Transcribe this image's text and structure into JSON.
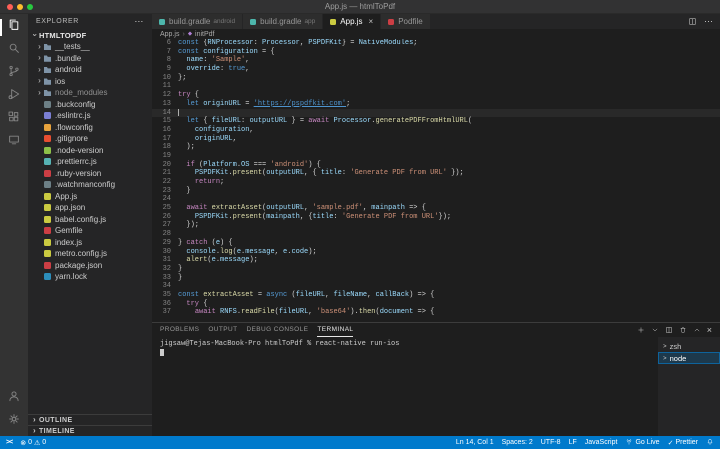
{
  "colors": {
    "accent": "#007acc",
    "traffic_lights": [
      "#ff5f57",
      "#febc2e",
      "#28c840"
    ],
    "folder_icon": "#7e93a7"
  },
  "glyphs": {
    "more": "⋯",
    "close": "×",
    "chevron": "›",
    "check": "✓",
    "error": "⊗",
    "warning": "⚠"
  },
  "title_bar": {
    "title": "App.js — htmlToPdf"
  },
  "activity_bar": {
    "items": [
      {
        "name": "explorer",
        "active": true
      },
      {
        "name": "search"
      },
      {
        "name": "source-control"
      },
      {
        "name": "run-debug"
      },
      {
        "name": "extensions"
      },
      {
        "name": "remote-explorer"
      }
    ],
    "bottom": [
      {
        "name": "account"
      },
      {
        "name": "settings"
      }
    ]
  },
  "sidebar": {
    "header": "EXPLORER",
    "section": "HTMLTOPDF",
    "files": [
      {
        "name": "__tests__",
        "kind": "folder"
      },
      {
        "name": ".bundle",
        "kind": "folder"
      },
      {
        "name": "android",
        "kind": "folder"
      },
      {
        "name": "ios",
        "kind": "folder"
      },
      {
        "name": "node_modules",
        "kind": "folder",
        "dim": true
      },
      {
        "name": ".buckconfig",
        "color": "#6d8086"
      },
      {
        "name": ".eslintrc.js",
        "color": "#7b7fd4"
      },
      {
        "name": ".flowconfig",
        "color": "#e8a33d"
      },
      {
        "name": ".gitignore",
        "color": "#e84e31"
      },
      {
        "name": ".node-version",
        "color": "#8dc149"
      },
      {
        "name": ".prettierrc.js",
        "color": "#56b3b4"
      },
      {
        "name": ".ruby-version",
        "color": "#cc3e44"
      },
      {
        "name": ".watchmanconfig",
        "color": "#6d8086"
      },
      {
        "name": "App.js",
        "color": "#cbcb41"
      },
      {
        "name": "app.json",
        "color": "#cbcb41"
      },
      {
        "name": "babel.config.js",
        "color": "#cbcb41"
      },
      {
        "name": "Gemfile",
        "color": "#cc3e44"
      },
      {
        "name": "index.js",
        "color": "#cbcb41"
      },
      {
        "name": "metro.config.js",
        "color": "#cbcb41"
      },
      {
        "name": "package.json",
        "color": "#cc3e44"
      },
      {
        "name": "yarn.lock",
        "color": "#2c8ebb"
      }
    ],
    "panels": [
      "OUTLINE",
      "TIMELINE"
    ]
  },
  "tabs": [
    {
      "label": "build.gradle",
      "detail": "android",
      "icon_color": "#4db6ac"
    },
    {
      "label": "build.gradle",
      "detail": "app",
      "icon_color": "#4db6ac"
    },
    {
      "label": "App.js",
      "icon_color": "#cbcb41",
      "active": true,
      "closable": true
    },
    {
      "label": "Podfile",
      "icon_color": "#cc3e44"
    }
  ],
  "breadcrumb": {
    "items": [
      "App.js",
      "initPdf"
    ]
  },
  "editor": {
    "cursor_line": 14,
    "lines": [
      {
        "n": 6,
        "t": [
          [
            "k",
            "const"
          ],
          [
            "p",
            " {"
          ],
          [
            "v",
            "RNProcessor"
          ],
          [
            "p",
            ": "
          ],
          [
            "v",
            "Processor"
          ],
          [
            "p",
            ", "
          ],
          [
            "v",
            "PSPDFKit"
          ],
          [
            "p",
            "} = "
          ],
          [
            "v",
            "NativeModules"
          ],
          [
            "p",
            ";"
          ]
        ]
      },
      {
        "n": 7,
        "t": [
          [
            "k",
            "const"
          ],
          [
            "p",
            " "
          ],
          [
            "v",
            "configuration"
          ],
          [
            "p",
            " = {"
          ]
        ]
      },
      {
        "n": 8,
        "t": [
          [
            "p",
            "  "
          ],
          [
            "v",
            "name"
          ],
          [
            "p",
            ": "
          ],
          [
            "s",
            "'Sample'"
          ],
          [
            "p",
            ","
          ]
        ]
      },
      {
        "n": 9,
        "t": [
          [
            "p",
            "  "
          ],
          [
            "v",
            "override"
          ],
          [
            "p",
            ": "
          ],
          [
            "b",
            "true"
          ],
          [
            "p",
            ","
          ]
        ]
      },
      {
        "n": 10,
        "t": [
          [
            "p",
            "};"
          ]
        ]
      },
      {
        "n": 11,
        "t": []
      },
      {
        "n": 12,
        "t": [
          [
            "c",
            "try"
          ],
          [
            "p",
            " {"
          ]
        ]
      },
      {
        "n": 13,
        "t": [
          [
            "p",
            "  "
          ],
          [
            "k",
            "let"
          ],
          [
            "p",
            " "
          ],
          [
            "v",
            "originURL"
          ],
          [
            "p",
            " = "
          ],
          [
            "u",
            "'https://pspdfkit.com'"
          ],
          [
            "p",
            ";"
          ]
        ]
      },
      {
        "n": 14,
        "t": []
      },
      {
        "n": 15,
        "t": [
          [
            "p",
            "  "
          ],
          [
            "k",
            "let"
          ],
          [
            "p",
            " { "
          ],
          [
            "v",
            "fileURL"
          ],
          [
            "p",
            ": "
          ],
          [
            "v",
            "outputURL"
          ],
          [
            "p",
            " } = "
          ],
          [
            "c",
            "await"
          ],
          [
            "p",
            " "
          ],
          [
            "v",
            "Processor"
          ],
          [
            "p",
            "."
          ],
          [
            "f",
            "generatePDFFromHtmlURL"
          ],
          [
            "p",
            "("
          ]
        ]
      },
      {
        "n": 16,
        "t": [
          [
            "p",
            "    "
          ],
          [
            "v",
            "configuration"
          ],
          [
            "p",
            ","
          ]
        ]
      },
      {
        "n": 17,
        "t": [
          [
            "p",
            "    "
          ],
          [
            "v",
            "originURL"
          ],
          [
            "p",
            ","
          ]
        ]
      },
      {
        "n": 18,
        "t": [
          [
            "p",
            "  );"
          ]
        ]
      },
      {
        "n": 19,
        "t": []
      },
      {
        "n": 20,
        "t": [
          [
            "p",
            "  "
          ],
          [
            "c",
            "if"
          ],
          [
            "p",
            " ("
          ],
          [
            "v",
            "Platform"
          ],
          [
            "p",
            "."
          ],
          [
            "v",
            "OS"
          ],
          [
            "p",
            " === "
          ],
          [
            "s",
            "'android'"
          ],
          [
            "p",
            ") {"
          ]
        ]
      },
      {
        "n": 21,
        "t": [
          [
            "p",
            "    "
          ],
          [
            "v",
            "PSPDFKit"
          ],
          [
            "p",
            "."
          ],
          [
            "f",
            "present"
          ],
          [
            "p",
            "("
          ],
          [
            "v",
            "outputURL"
          ],
          [
            "p",
            ", { "
          ],
          [
            "v",
            "title"
          ],
          [
            "p",
            ": "
          ],
          [
            "s",
            "'Generate PDF from URL'"
          ],
          [
            "p",
            " });"
          ]
        ]
      },
      {
        "n": 22,
        "t": [
          [
            "p",
            "    "
          ],
          [
            "c",
            "return"
          ],
          [
            "p",
            ";"
          ]
        ]
      },
      {
        "n": 23,
        "t": [
          [
            "p",
            "  }"
          ]
        ]
      },
      {
        "n": 24,
        "t": []
      },
      {
        "n": 25,
        "t": [
          [
            "p",
            "  "
          ],
          [
            "c",
            "await"
          ],
          [
            "p",
            " "
          ],
          [
            "f",
            "extractAsset"
          ],
          [
            "p",
            "("
          ],
          [
            "v",
            "outputURL"
          ],
          [
            "p",
            ", "
          ],
          [
            "s",
            "'sample.pdf'"
          ],
          [
            "p",
            ", "
          ],
          [
            "v",
            "mainpath"
          ],
          [
            "p",
            " => {"
          ]
        ]
      },
      {
        "n": 26,
        "t": [
          [
            "p",
            "    "
          ],
          [
            "v",
            "PSPDFKit"
          ],
          [
            "p",
            "."
          ],
          [
            "f",
            "present"
          ],
          [
            "p",
            "("
          ],
          [
            "v",
            "mainpath"
          ],
          [
            "p",
            ", {"
          ],
          [
            "v",
            "title"
          ],
          [
            "p",
            ": "
          ],
          [
            "s",
            "'Generate PDF from URL'"
          ],
          [
            "p",
            "});"
          ]
        ]
      },
      {
        "n": 27,
        "t": [
          [
            "p",
            "  });"
          ]
        ]
      },
      {
        "n": 28,
        "t": []
      },
      {
        "n": 29,
        "t": [
          [
            "p",
            "} "
          ],
          [
            "c",
            "catch"
          ],
          [
            "p",
            " ("
          ],
          [
            "v",
            "e"
          ],
          [
            "p",
            ") {"
          ]
        ]
      },
      {
        "n": 30,
        "t": [
          [
            "p",
            "  "
          ],
          [
            "v",
            "console"
          ],
          [
            "p",
            "."
          ],
          [
            "f",
            "log"
          ],
          [
            "p",
            "("
          ],
          [
            "v",
            "e"
          ],
          [
            "p",
            "."
          ],
          [
            "v",
            "message"
          ],
          [
            "p",
            ", "
          ],
          [
            "v",
            "e"
          ],
          [
            "p",
            "."
          ],
          [
            "v",
            "code"
          ],
          [
            "p",
            ");"
          ]
        ]
      },
      {
        "n": 31,
        "t": [
          [
            "p",
            "  "
          ],
          [
            "f",
            "alert"
          ],
          [
            "p",
            "("
          ],
          [
            "v",
            "e"
          ],
          [
            "p",
            "."
          ],
          [
            "v",
            "message"
          ],
          [
            "p",
            ");"
          ]
        ]
      },
      {
        "n": 32,
        "t": [
          [
            "p",
            "}"
          ]
        ]
      },
      {
        "n": 33,
        "t": [
          [
            "p",
            "}"
          ]
        ]
      },
      {
        "n": 34,
        "t": []
      },
      {
        "n": 35,
        "t": [
          [
            "k",
            "const"
          ],
          [
            "p",
            " "
          ],
          [
            "f",
            "extractAsset"
          ],
          [
            "p",
            " = "
          ],
          [
            "k",
            "async"
          ],
          [
            "p",
            " ("
          ],
          [
            "v",
            "fileURL"
          ],
          [
            "p",
            ", "
          ],
          [
            "v",
            "fileName"
          ],
          [
            "p",
            ", "
          ],
          [
            "v",
            "callBack"
          ],
          [
            "p",
            ") => {"
          ]
        ]
      },
      {
        "n": 36,
        "t": [
          [
            "p",
            "  "
          ],
          [
            "c",
            "try"
          ],
          [
            "p",
            " {"
          ]
        ]
      },
      {
        "n": 37,
        "t": [
          [
            "p",
            "    "
          ],
          [
            "c",
            "await"
          ],
          [
            "p",
            " "
          ],
          [
            "v",
            "RNFS"
          ],
          [
            "p",
            "."
          ],
          [
            "f",
            "readFile"
          ],
          [
            "p",
            "("
          ],
          [
            "v",
            "fileURL"
          ],
          [
            "p",
            ", "
          ],
          [
            "s",
            "'base64'"
          ],
          [
            "p",
            ")."
          ],
          [
            "f",
            "then"
          ],
          [
            "p",
            "("
          ],
          [
            "v",
            "document"
          ],
          [
            "p",
            " => {"
          ]
        ]
      }
    ]
  },
  "panel": {
    "tabs": [
      "PROBLEMS",
      "OUTPUT",
      "DEBUG CONSOLE",
      "TERMINAL"
    ],
    "active_tab": "TERMINAL",
    "terminal": {
      "prompt": "jigsaw@Tejas-MacBook-Pro htmlToPdf % react-native run-ios"
    },
    "sessions": [
      {
        "label": "zsh"
      },
      {
        "label": "node",
        "selected": true
      }
    ]
  },
  "status_bar": {
    "remote_label": "><",
    "problems": {
      "errors": "0",
      "warnings": "0"
    },
    "right": [
      {
        "name": "cursor-position",
        "label": "Ln 14, Col 1"
      },
      {
        "name": "indentation",
        "label": "Spaces: 2"
      },
      {
        "name": "encoding",
        "label": "UTF-8"
      },
      {
        "name": "eol",
        "label": "LF"
      },
      {
        "name": "language",
        "label": "JavaScript"
      },
      {
        "name": "go-live",
        "label": "Go Live",
        "icon": "broadcast"
      },
      {
        "name": "prettier",
        "label": "Prettier",
        "check": true
      },
      {
        "name": "notifications",
        "icon": "bell"
      }
    ]
  }
}
